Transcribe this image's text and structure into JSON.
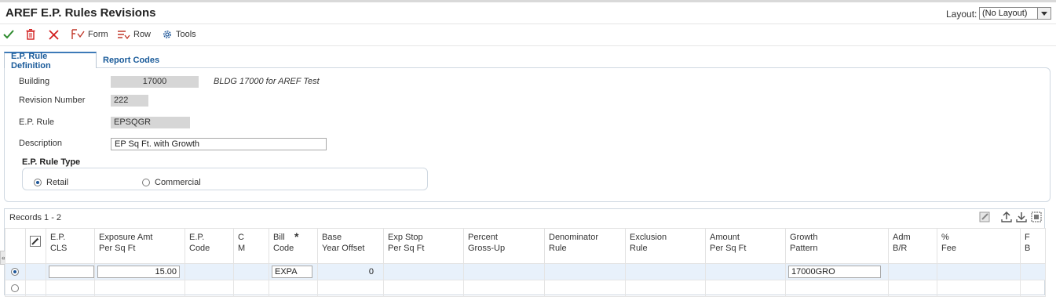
{
  "window": {
    "title": "AREF E.P. Rules Revisions"
  },
  "layout": {
    "label": "Layout:",
    "value": "(No Layout)"
  },
  "toolbar": {
    "ok_icon": "checkmark-icon",
    "delete_icon": "trash-icon",
    "cancel_icon": "x-icon",
    "form_label": "Form",
    "row_label": "Row",
    "tools_label": "Tools",
    "accent": "#1e5799",
    "ok_color": "#2e8b2e",
    "cancel_color": "#d22020"
  },
  "tabs": [
    {
      "label": "E.P. Rule Definition",
      "active": true
    },
    {
      "label": "Report Codes",
      "active": false
    }
  ],
  "form": {
    "building_label": "Building",
    "building_value": "17000",
    "building_desc": "BLDG 17000 for AREF Test",
    "revision_label": "Revision Number",
    "revision_value": "222",
    "rule_label": "E.P. Rule",
    "rule_value": "EPSQGR",
    "description_label": "Description",
    "description_value": "EP Sq Ft. with Growth",
    "rule_type_label": "E.P. Rule Type",
    "rule_type_options": [
      {
        "label": "Retail",
        "selected": true
      },
      {
        "label": "Commercial",
        "selected": false
      }
    ]
  },
  "grid": {
    "records_label": "Records 1 - 2",
    "columns": [
      {
        "line1": "E.P.",
        "line2": "CLS"
      },
      {
        "line1": "Exposure Amt",
        "line2": "Per Sq Ft"
      },
      {
        "line1": "E.P.",
        "line2": "Code"
      },
      {
        "line1": "C",
        "line2": "M"
      },
      {
        "line1": "Bill",
        "line2": "Code"
      },
      {
        "line1": "Base",
        "line2": "Year Offset"
      },
      {
        "line1": "Exp Stop",
        "line2": "Per Sq Ft"
      },
      {
        "line1": "Percent",
        "line2": "Gross-Up"
      },
      {
        "line1": "Denominator",
        "line2": "Rule"
      },
      {
        "line1": "Exclusion",
        "line2": "Rule"
      },
      {
        "line1": "Amount",
        "line2": "Per Sq Ft"
      },
      {
        "line1": "Growth",
        "line2": "Pattern"
      },
      {
        "line1": "Adm",
        "line2": "B/R"
      },
      {
        "line1": "%",
        "line2": "Fee"
      },
      {
        "line1": "F",
        "line2": "B"
      }
    ],
    "required_marker": "*",
    "rows": [
      {
        "selected": true,
        "cells": [
          "",
          "15.00",
          "",
          "",
          "EXPA",
          "0",
          "",
          "",
          "",
          "",
          "",
          "17000GRO",
          "",
          "",
          ""
        ]
      },
      {
        "selected": false,
        "cells": [
          "",
          "",
          "",
          "",
          "",
          "",
          "",
          "",
          "",
          "",
          "",
          "",
          "",
          "",
          ""
        ]
      }
    ],
    "collapse_glyph": "«"
  }
}
